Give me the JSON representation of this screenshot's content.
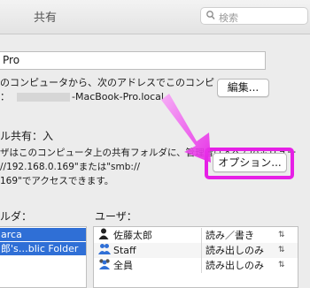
{
  "window": {
    "title": "共有"
  },
  "search": {
    "placeholder": "検索"
  },
  "computer_name": {
    "value": "Pro"
  },
  "description": {
    "line1": "のコンピュータから、次のアドレスでこのコンピ",
    "line2_prefix": "：",
    "line2_suffix": "-MacBook-Pro.local",
    "edit_button": "編集..."
  },
  "file_sharing": {
    "title": "ル共有：入",
    "line1": "ザはこのコンピュータ上の共有フォルダに、管理者はすべてのボリュー",
    "line2": "//192.168.0.169\"または\"smb://",
    "line3": "169\"でアクセスできます。",
    "options_button": "オプション..."
  },
  "folders": {
    "label": "ルダ：",
    "items": [
      "arca",
      "郎's…blic Folder"
    ]
  },
  "users": {
    "label": "ユーザ：",
    "rows": [
      {
        "name": "佐藤太郎",
        "permission": "読み／書き",
        "icon": "user-icon"
      },
      {
        "name": "Staff",
        "permission": "読み出しのみ",
        "icon": "group-icon"
      },
      {
        "name": "全員",
        "permission": "読み出しのみ",
        "icon": "everyone-icon"
      }
    ]
  },
  "colors": {
    "highlight": "#e61fe6",
    "selection": "#2f6fd6"
  }
}
